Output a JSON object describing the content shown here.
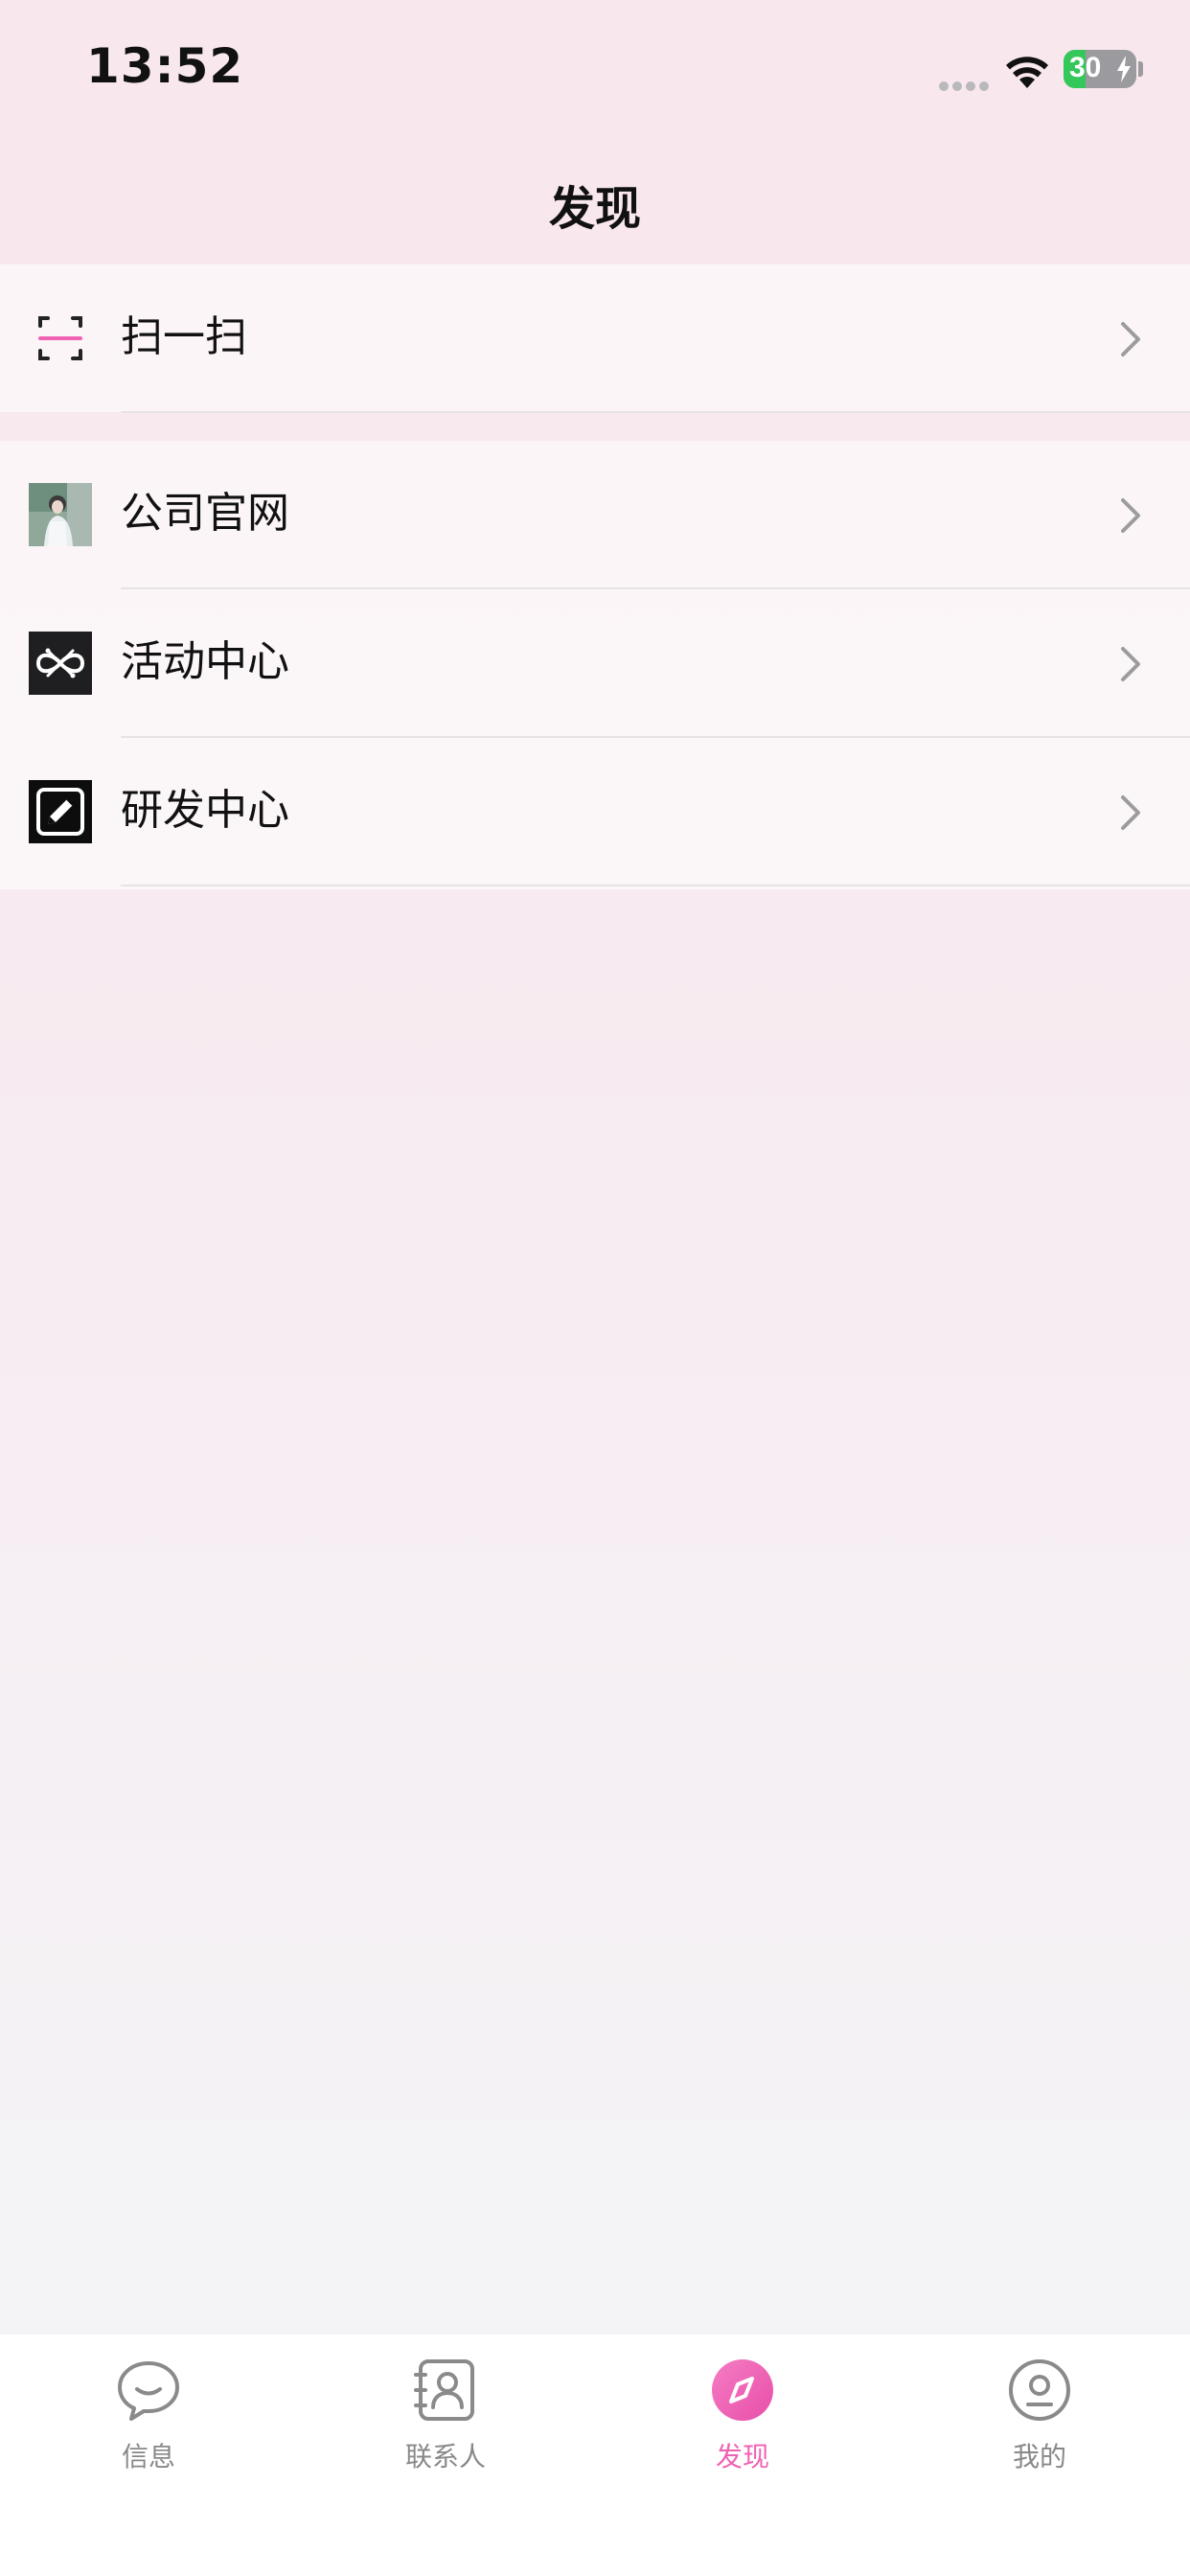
{
  "status_bar": {
    "time": "13:52",
    "battery_level": "30",
    "battery_fraction": 0.3,
    "battery_charging_icon": "bolt-icon"
  },
  "nav": {
    "title": "发现"
  },
  "groups": [
    {
      "items": [
        {
          "label": "扫一扫",
          "icon": "scan-icon"
        }
      ]
    },
    {
      "items": [
        {
          "label": "公司官网",
          "icon": "company-website-thumbnail"
        },
        {
          "label": "活动中心",
          "icon": "activity-center-icon"
        },
        {
          "label": "研发中心",
          "icon": "rd-center-edit-icon"
        }
      ]
    }
  ],
  "tabs": [
    {
      "label": "信息",
      "icon": "chat-bubble-icon",
      "active": false
    },
    {
      "label": "联系人",
      "icon": "contacts-book-icon",
      "active": false
    },
    {
      "label": "发现",
      "icon": "compass-icon",
      "active": true
    },
    {
      "label": "我的",
      "icon": "profile-icon",
      "active": false
    }
  ],
  "colors": {
    "accent": "#ef62b3",
    "tab_inactive": "#888888",
    "background_top": "#f8e8ee",
    "background_bottom": "#f4f5f7"
  }
}
